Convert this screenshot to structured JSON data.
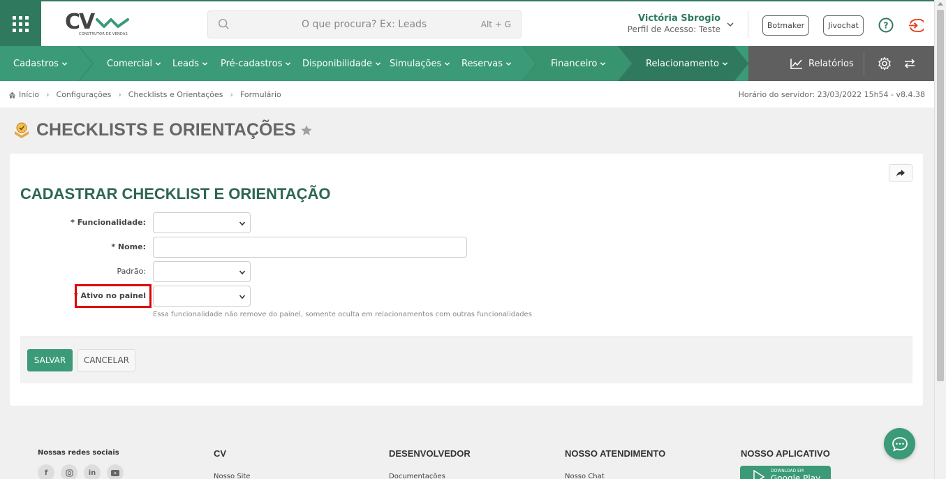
{
  "header": {
    "logo_text": "CV",
    "logo_sub": "CONSTRUTOR DE VENDAS",
    "search_placeholder": "O que procura? Ex: Leads",
    "search_shortcut": "Alt + G",
    "user_name": "Victória Sbrogio",
    "user_profile": "Perfil de Acesso: Teste",
    "botmaker_label": "Botmaker",
    "jivochat_label": "Jivochat"
  },
  "nav": {
    "items": [
      {
        "label": "Cadastros"
      },
      {
        "label": "Comercial"
      },
      {
        "label": "Leads"
      },
      {
        "label": "Pré-cadastros"
      },
      {
        "label": "Disponibilidade"
      },
      {
        "label": "Simulações"
      },
      {
        "label": "Reservas"
      },
      {
        "label": "Financeiro"
      },
      {
        "label": "Relacionamento"
      }
    ],
    "reports_label": "Relatórios"
  },
  "breadcrumb": {
    "items": [
      "Início",
      "Configurações",
      "Checklists e Orientações",
      "Formulário"
    ],
    "server_time": "Horário do servidor: 23/03/2022 15h54 - v8.4.38"
  },
  "page": {
    "title": "CHECKLISTS E ORIENTAÇÕES"
  },
  "form": {
    "title": "CADASTRAR CHECKLIST E ORIENTAÇÃO",
    "fields": {
      "funcionalidade_label": "* Funcionalidade:",
      "nome_label": "* Nome:",
      "padrao_label": "Padrão:",
      "ativo_label": "* Ativo no painel",
      "ativo_hint": "Essa funcionalidade não remove do painel, somente oculta em relacionamentos com outras funcionalidades"
    },
    "save_label": "SALVAR",
    "cancel_label": "CANCELAR"
  },
  "footer": {
    "social_heading": "Nossas redes sociais",
    "col_cv": "CV",
    "col_dev": "DESENVOLVEDOR",
    "col_support": "NOSSO ATENDIMENTO",
    "col_app": "NOSSO APLICATIVO",
    "link_site": "Nosso Site",
    "link_docs": "Documentações",
    "link_chat": "Nosso Chat",
    "gplay_small": "DOWNLOAD EM",
    "gplay_big": "Google Play"
  },
  "colors": {
    "primary": "#3b9a77",
    "primary_dark": "#2f7a5f",
    "highlight": "#e00000",
    "logout": "#e2401c"
  }
}
